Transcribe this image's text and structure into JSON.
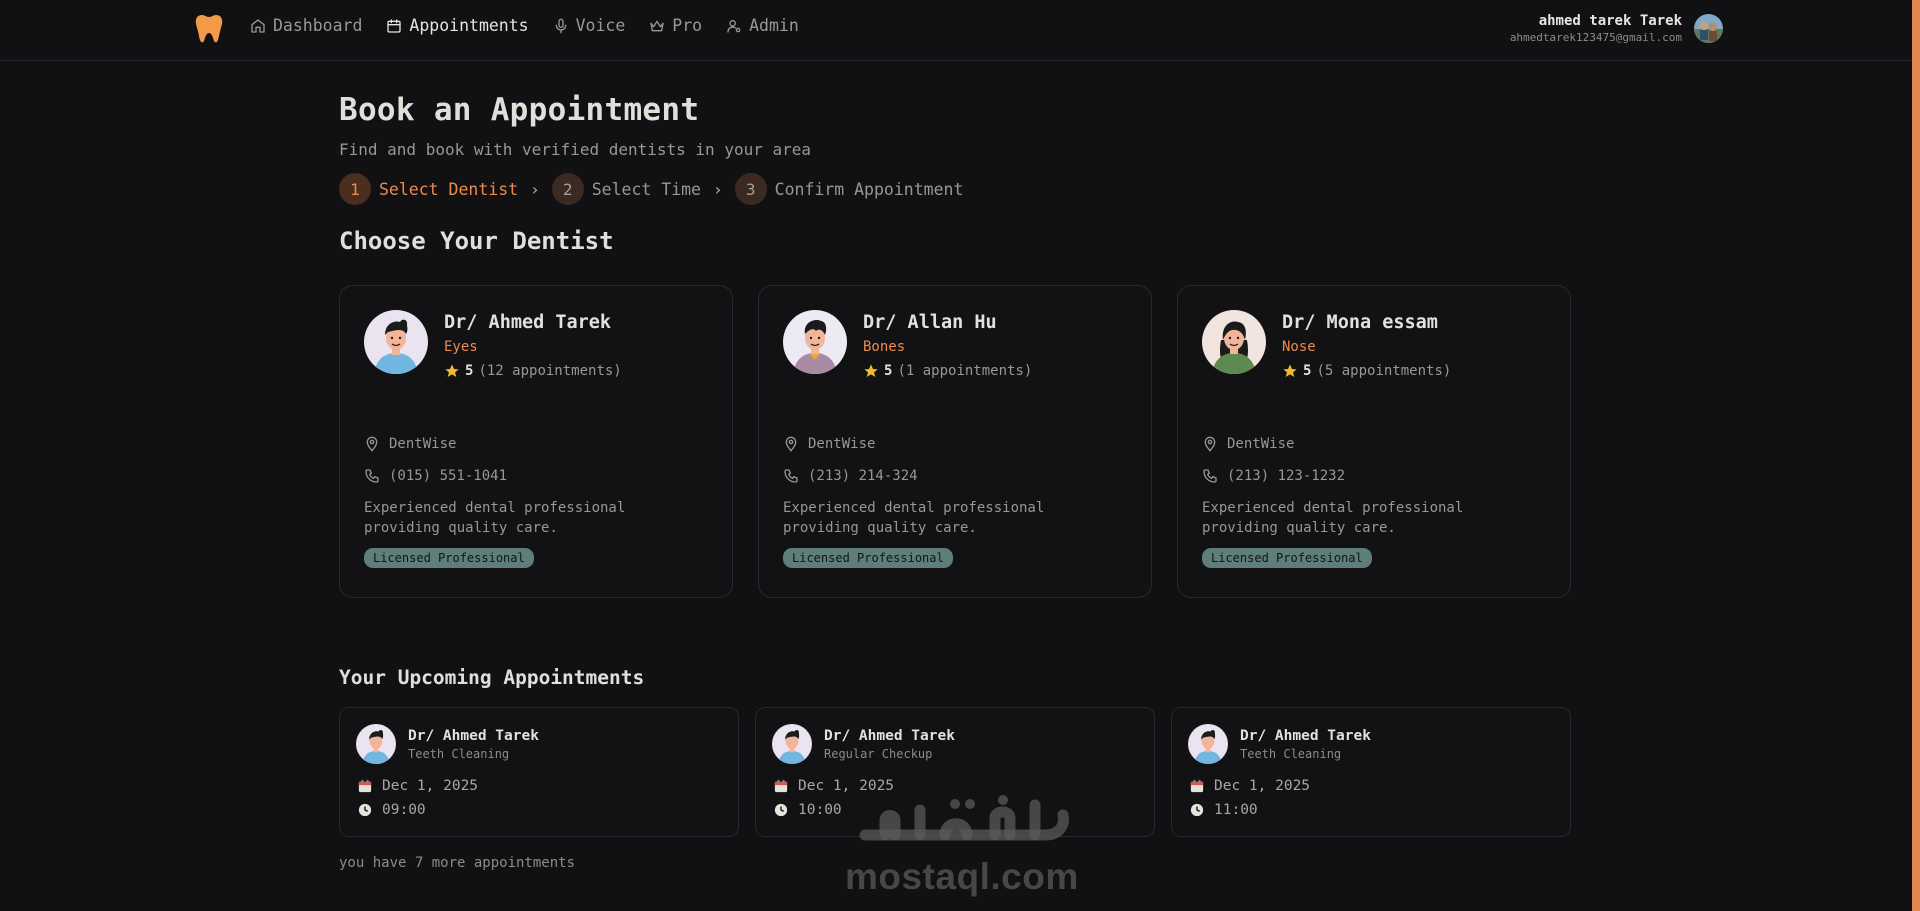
{
  "nav": {
    "items": [
      {
        "label": "Dashboard",
        "icon": "home-icon",
        "active": false
      },
      {
        "label": "Appointments",
        "icon": "calendar-icon",
        "active": true
      },
      {
        "label": "Voice",
        "icon": "mic-icon",
        "active": false
      },
      {
        "label": "Pro",
        "icon": "crown-icon",
        "active": false
      },
      {
        "label": "Admin",
        "icon": "user-cog-icon",
        "active": false
      }
    ]
  },
  "user": {
    "name": "ahmed tarek Tarek",
    "email": "ahmedtarek123475@gmail.com"
  },
  "page": {
    "title": "Book an Appointment",
    "subtitle": "Find and book with verified dentists in your area"
  },
  "steps": [
    {
      "num": "1",
      "label": "Select Dentist",
      "active": true
    },
    {
      "num": "2",
      "label": "Select Time",
      "active": false
    },
    {
      "num": "3",
      "label": "Confirm Appointment",
      "active": false
    }
  ],
  "dentists_section": {
    "title": "Choose Your Dentist"
  },
  "dentists": [
    {
      "name": "Dr/ Ahmed Tarek",
      "specialty": "Eyes",
      "rating": "5",
      "appointments": "(12 appointments)",
      "location": "DentWise",
      "phone": "(015) 551-1041",
      "description": "Experienced dental professional providing quality care.",
      "badge": "Licensed Professional"
    },
    {
      "name": "Dr/ Allan Hu",
      "specialty": "Bones",
      "rating": "5",
      "appointments": "(1 appointments)",
      "location": "DentWise",
      "phone": "(213) 214-324",
      "description": "Experienced dental professional providing quality care.",
      "badge": "Licensed Professional"
    },
    {
      "name": "Dr/ Mona essam",
      "specialty": "Nose",
      "rating": "5",
      "appointments": "(5 appointments)",
      "location": "DentWise",
      "phone": "(213) 123-1232",
      "description": "Experienced dental professional providing quality care.",
      "badge": "Licensed Professional"
    }
  ],
  "upcoming": {
    "title": "Your Upcoming Appointments",
    "items": [
      {
        "doctor": "Dr/ Ahmed Tarek",
        "type": "Teeth Cleaning",
        "date": "Dec 1, 2025",
        "time": "09:00"
      },
      {
        "doctor": "Dr/ Ahmed Tarek",
        "type": "Regular Checkup",
        "date": "Dec 1, 2025",
        "time": "10:00"
      },
      {
        "doctor": "Dr/ Ahmed Tarek",
        "type": "Teeth Cleaning",
        "date": "Dec 1, 2025",
        "time": "11:00"
      }
    ],
    "more_text": "you have 7 more appointments"
  },
  "watermark": {
    "latin": "mostaql.com",
    "arabic": "مستقل"
  },
  "colors": {
    "accent": "#ef8a4f",
    "background": "#111113",
    "badge": "#5f7d7b",
    "star": "#f5b82e"
  }
}
